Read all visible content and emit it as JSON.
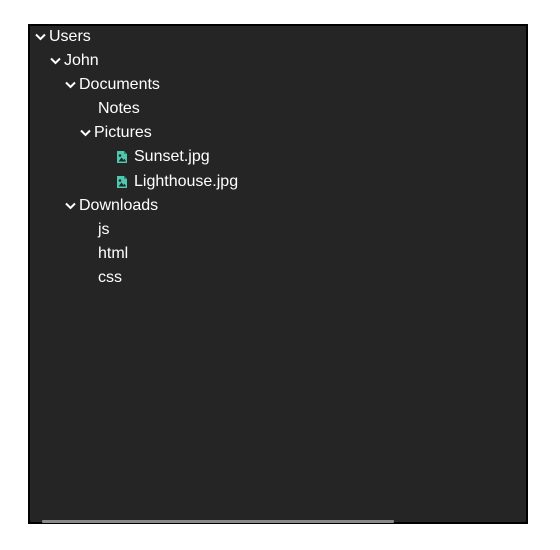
{
  "tree": {
    "users": {
      "label": "Users",
      "icon": "chevron-down-icon"
    },
    "john": {
      "label": "John",
      "icon": "chevron-down-icon"
    },
    "documents": {
      "label": "Documents",
      "icon": "chevron-down-icon"
    },
    "notes": {
      "label": "Notes"
    },
    "pictures": {
      "label": "Pictures",
      "icon": "chevron-down-icon"
    },
    "sunset": {
      "label": "Sunset.jpg",
      "icon": "image-file-icon"
    },
    "lighthouse": {
      "label": "Lighthouse.jpg",
      "icon": "image-file-icon"
    },
    "downloads": {
      "label": "Downloads",
      "icon": "chevron-down-icon"
    },
    "js": {
      "label": "js"
    },
    "html": {
      "label": "html"
    },
    "css": {
      "label": "css"
    }
  },
  "colors": {
    "panel_background": "#252526",
    "text": "#ffffff",
    "image_icon": "#4ec9b0",
    "scrollbar": "#8a8a8a"
  }
}
